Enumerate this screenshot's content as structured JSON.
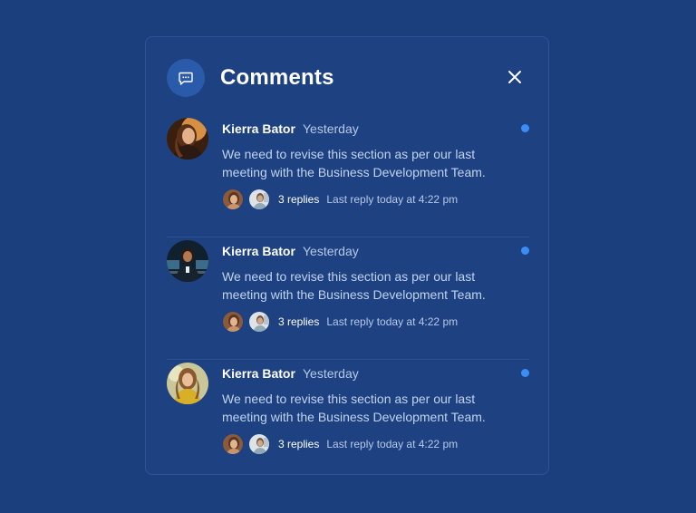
{
  "colors": {
    "background": "#1b3e7c",
    "panel": "#1d4181",
    "accent": "#3d8cf5"
  },
  "header": {
    "icon": "chat-icon",
    "title": "Comments",
    "close_icon": "close-icon"
  },
  "comments": [
    {
      "author": "Kierra Bator",
      "time": "Yesterday",
      "message": "We need to revise this section as per our last meeting with the Business Development Team.",
      "replies": "3 replies",
      "last_reply": "Last reply today at 4:22 pm",
      "unread": true
    },
    {
      "author": "Kierra Bator",
      "time": "Yesterday",
      "message": "We need to revise this section as per our last meeting with the Business Development Team.",
      "replies": "3 replies",
      "last_reply": "Last reply today at 4:22 pm",
      "unread": true
    },
    {
      "author": "Kierra Bator",
      "time": "Yesterday",
      "message": "We need to revise this section as per our last meeting with the Business Development Team.",
      "replies": "3 replies",
      "last_reply": "Last reply today at 4:22 pm",
      "unread": true
    }
  ]
}
